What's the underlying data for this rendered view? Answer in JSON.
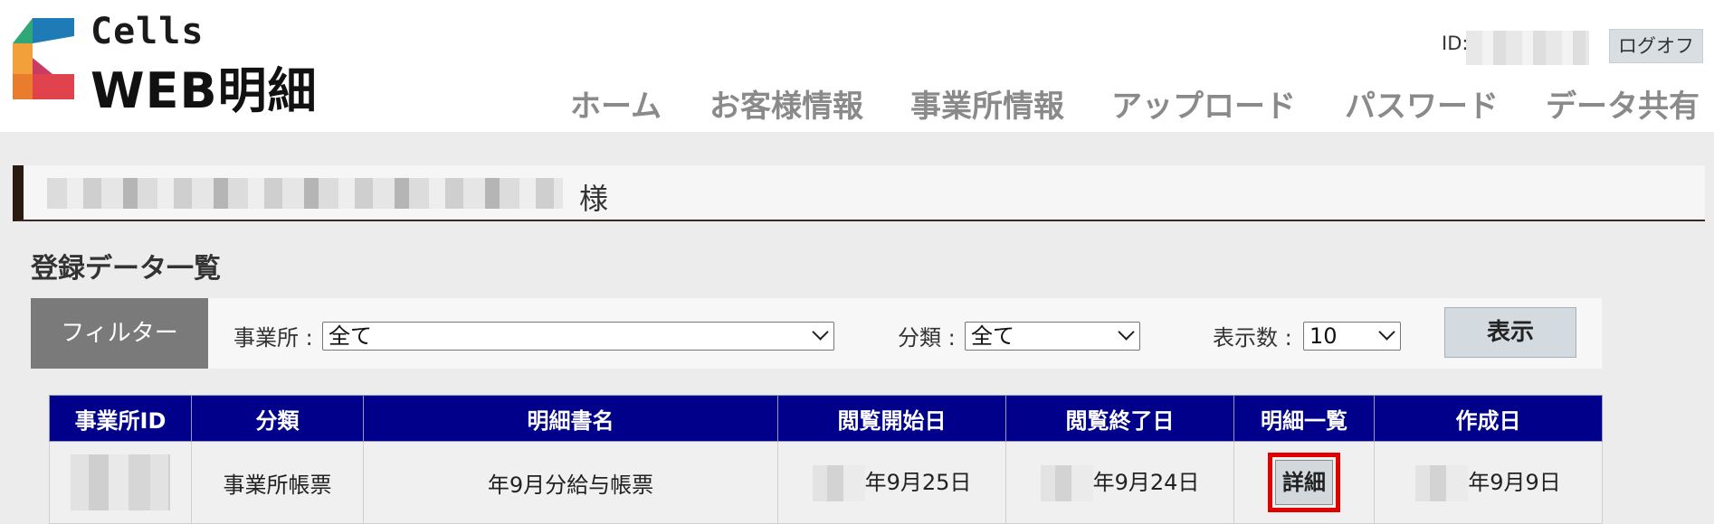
{
  "brand": {
    "line1": "Cells",
    "line2": "WEB明細"
  },
  "header": {
    "id_label": "ID:",
    "logout_label": "ログオフ"
  },
  "nav": [
    "ホーム",
    "お客様情報",
    "事業所情報",
    "アップロード",
    "パスワード",
    "データ共有"
  ],
  "customer": {
    "suffix": "様"
  },
  "section_title": "登録データ一覧",
  "filter": {
    "label": "フィルター",
    "office_label": "事業所 :",
    "office_value": "全て",
    "category_label": "分類 :",
    "category_value": "全て",
    "count_label": "表示数 :",
    "count_value": "10",
    "show_button": "表示"
  },
  "table": {
    "headers": [
      "事業所ID",
      "分類",
      "明細書名",
      "閲覧開始日",
      "閲覧終了日",
      "明細一覧",
      "作成日"
    ],
    "rows": [
      {
        "category": "事業所帳票",
        "name": "年9月分給与帳票",
        "start": "年9月25日",
        "end": "年9月24日",
        "detail": "詳細",
        "created": "年9月9日"
      }
    ]
  },
  "colors": {
    "header_bg": "#00008b",
    "highlight": "#e00000",
    "nav_text": "#8a8a8a",
    "button_bg": "#d4dbe0"
  }
}
